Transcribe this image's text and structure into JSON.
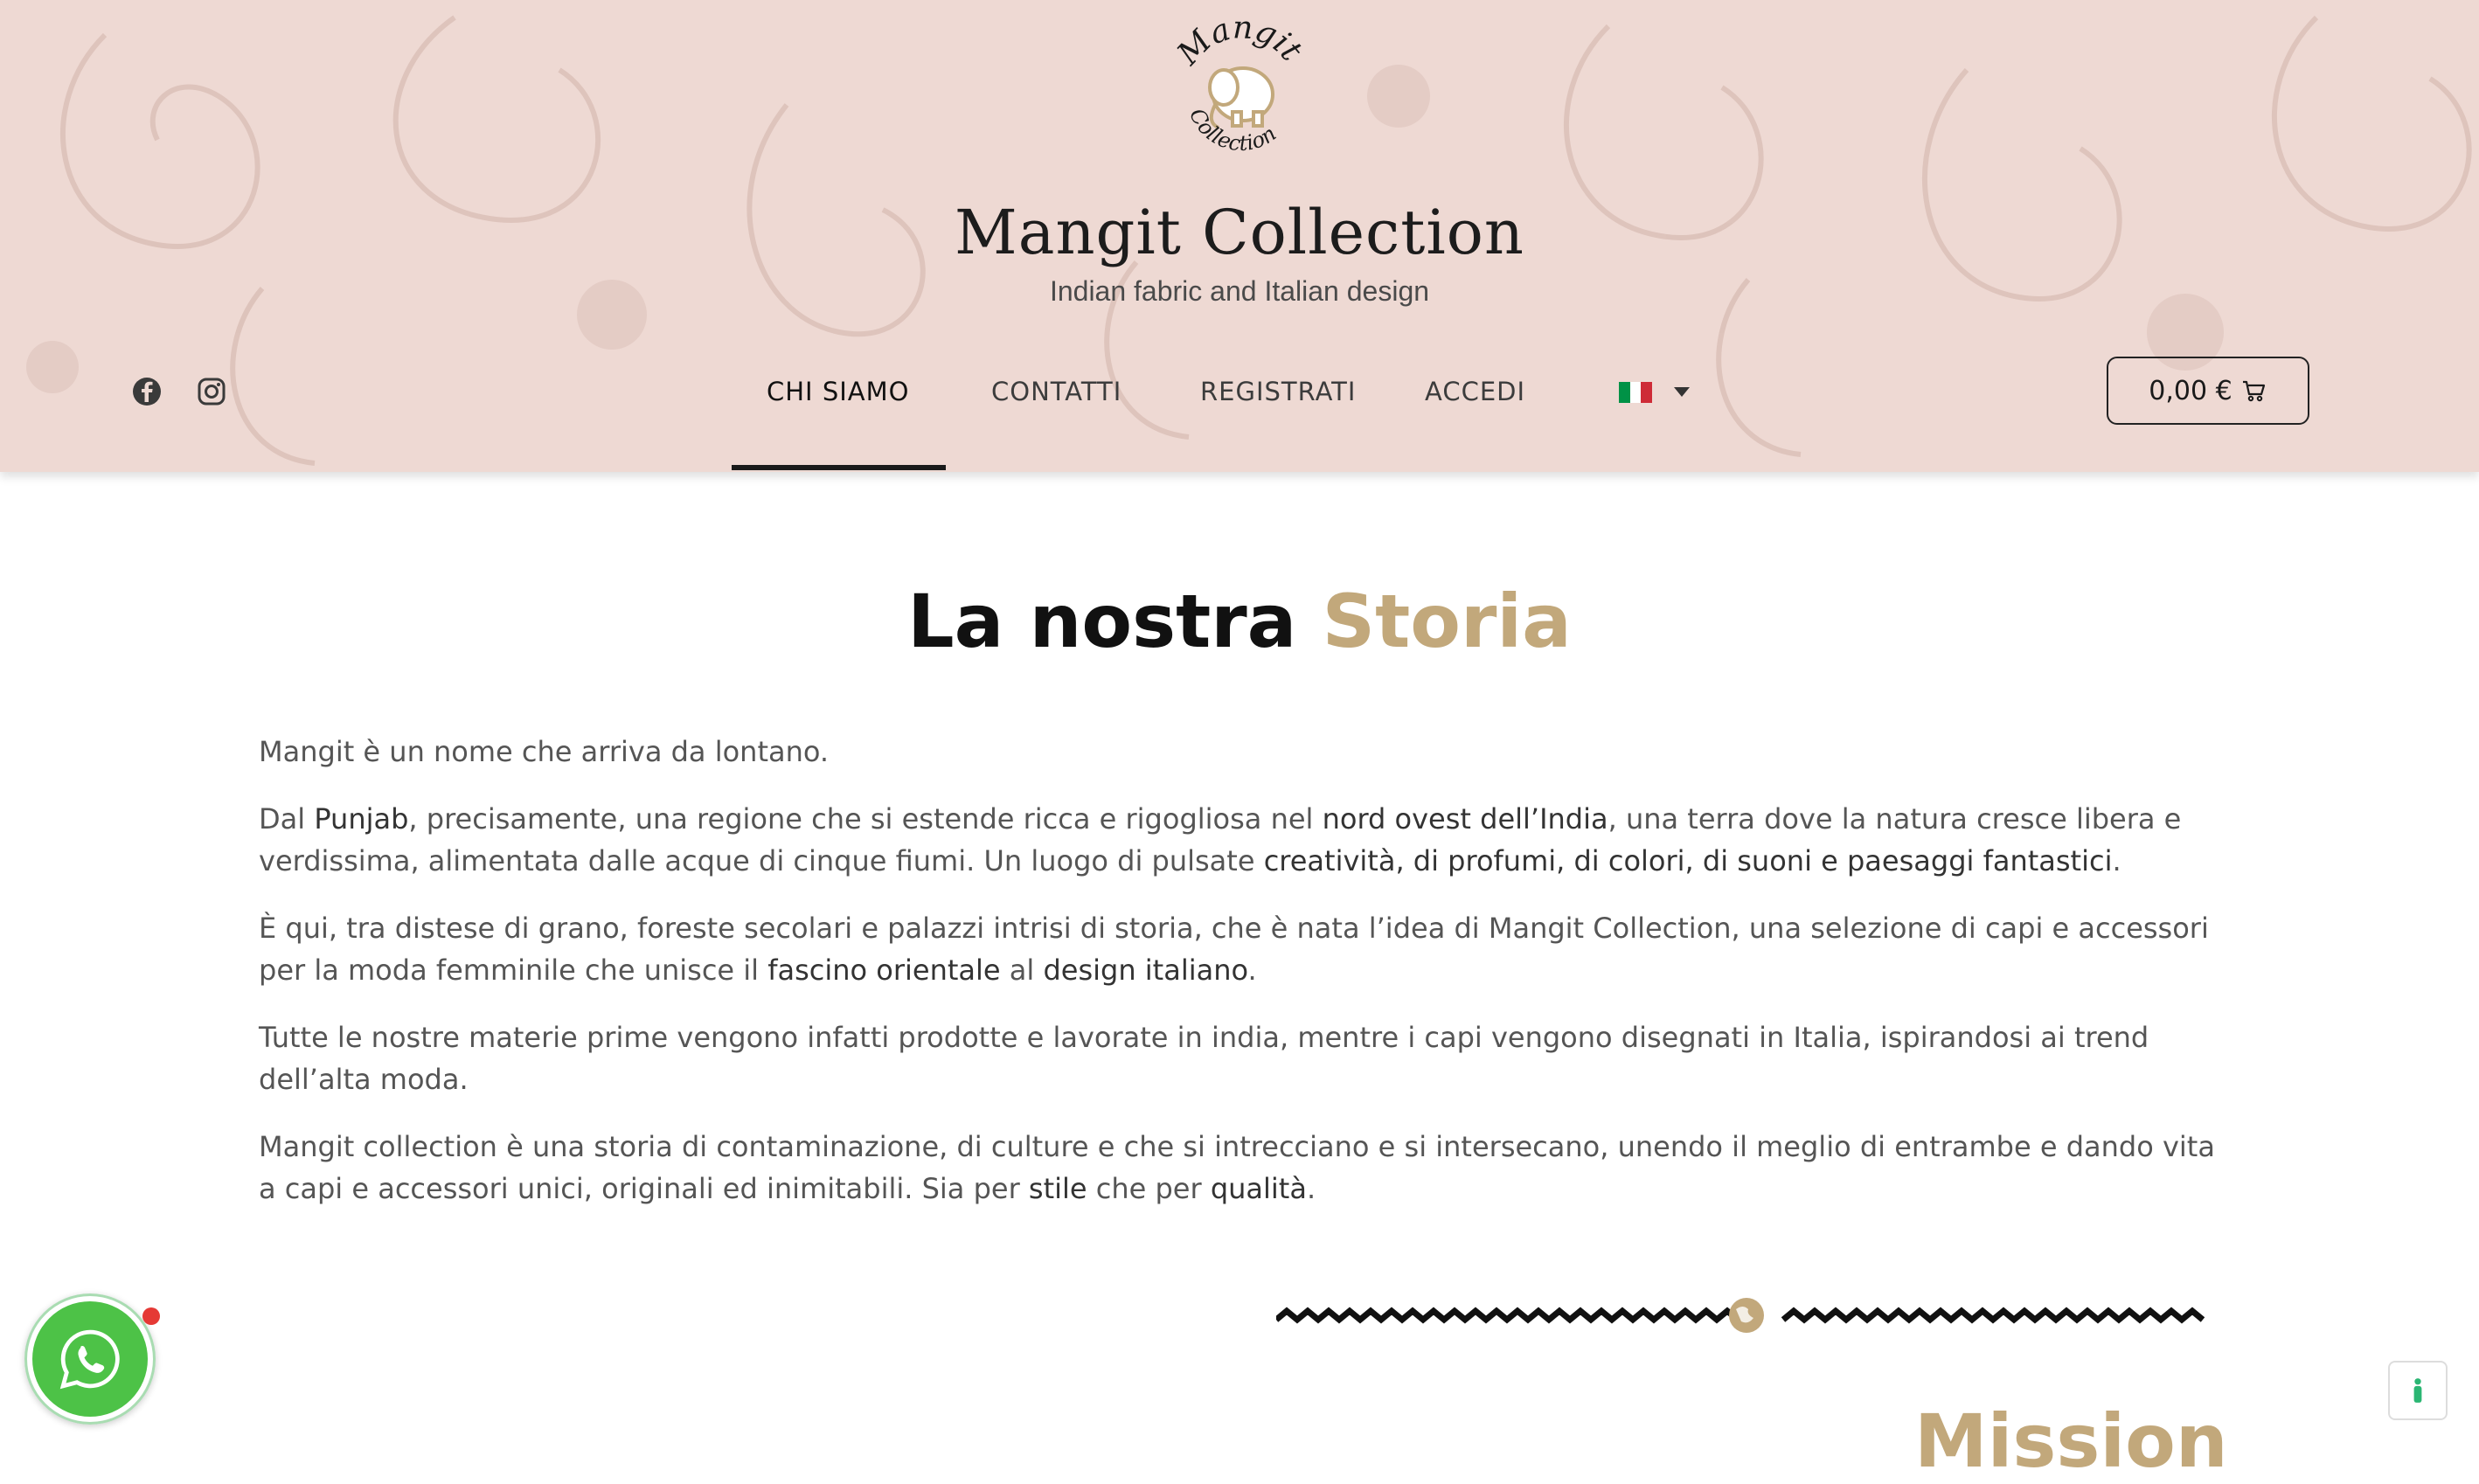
{
  "site": {
    "title": "Mangit Collection",
    "tagline": "Indian fabric and Italian design",
    "logo_text_top": "Mangit",
    "logo_text_bottom": "Collection"
  },
  "social": [
    {
      "name": "facebook",
      "icon": "facebook-icon"
    },
    {
      "name": "instagram",
      "icon": "instagram-icon"
    }
  ],
  "nav": {
    "items": [
      {
        "label": "CHI SIAMO",
        "active": true
      },
      {
        "label": "CONTATTI",
        "active": false
      },
      {
        "label": "REGISTRATI",
        "active": false
      },
      {
        "label": "ACCEDI",
        "active": false
      }
    ],
    "language": {
      "flag": "italy-flag-icon",
      "flag_colors": [
        "#009246",
        "#ffffff",
        "#ce2b37"
      ]
    }
  },
  "cart": {
    "amount": "0,00 €",
    "icon": "cart-icon"
  },
  "story": {
    "heading_main": "La nostra ",
    "heading_accent": "Storia",
    "p1": "Mangit è un nome che arriva da lontano.",
    "p2_a": "Dal ",
    "p2_b": "Punjab",
    "p2_c": ", precisamente, una regione che si estende ricca e rigogliosa nel ",
    "p2_d": "nord ovest dell’India",
    "p2_e": ", una terra dove la natura cresce libera e verdissima, alimentata dalle acque di cinque fiumi. Un luogo di pulsate ",
    "p2_f": "creatività, di profumi, di colori, di suoni e paesaggi fantastici",
    "p2_g": ".",
    "p3_a": "È qui, tra distese di grano, foreste secolari e palazzi intrisi di storia, che è nata l’idea di Mangit Collection, una selezione di capi e accessori per la moda femminile che unisce il ",
    "p3_b": "fascino orientale",
    "p3_c": " al ",
    "p3_d": "design italiano",
    "p3_e": ".",
    "p4": "Tutte le nostre materie prime vengono infatti prodotte e lavorate in india, mentre i capi vengono disegnati in Italia, ispirandosi ai trend dell’alta moda.",
    "p5_a": "Mangit collection è una storia di contaminazione, di culture e che si intrecciano e si intersecano, unendo il meglio di entrambe e dando vita a capi e accessori unici, originali ed inimitabili. Sia per ",
    "p5_b": "stile",
    "p5_c": " che per ",
    "p5_d": "qualità",
    "p5_e": "."
  },
  "mission": {
    "heading": "Mission"
  },
  "colors": {
    "header_bg": "#eed9d3",
    "accent": "#c2a87b",
    "whatsapp": "#4dc247"
  }
}
